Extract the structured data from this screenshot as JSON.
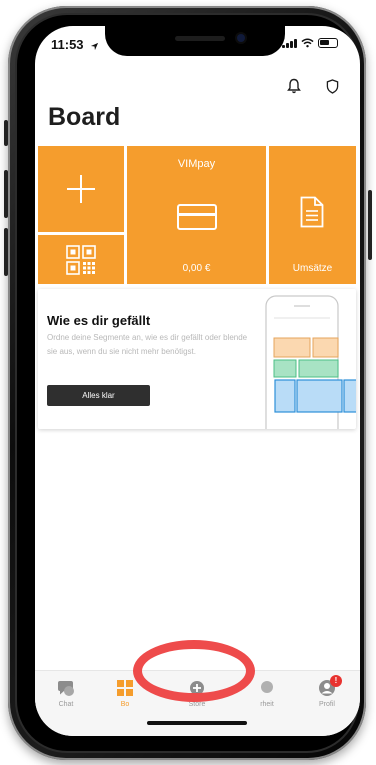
{
  "status_bar": {
    "time": "11:53"
  },
  "header": {
    "title": "Board"
  },
  "tiles": {
    "vimpay_title": "VIMpay",
    "vimpay_amount": "0,00 €",
    "umsatz_label": "Umsätze"
  },
  "info_card": {
    "title": "Wie es dir gefällt",
    "description": "Ordne deine Segmente an, wie es dir gefällt oder blende sie aus, wenn du sie nicht mehr benötigst.",
    "button_label": "Alles klar"
  },
  "tab_bar": {
    "items": [
      {
        "label": "Chat",
        "icon": "chat-icon"
      },
      {
        "label": "Bo",
        "icon": "board-icon"
      },
      {
        "label": "Store",
        "icon": "store-icon"
      },
      {
        "label": "rheit",
        "icon": "security-icon"
      },
      {
        "label": "Profil",
        "icon": "profile-icon",
        "badge": "!"
      }
    ]
  },
  "colors": {
    "accent": "#f59d2d",
    "highlight": "#ee4b4b",
    "badge": "#e8322f"
  }
}
